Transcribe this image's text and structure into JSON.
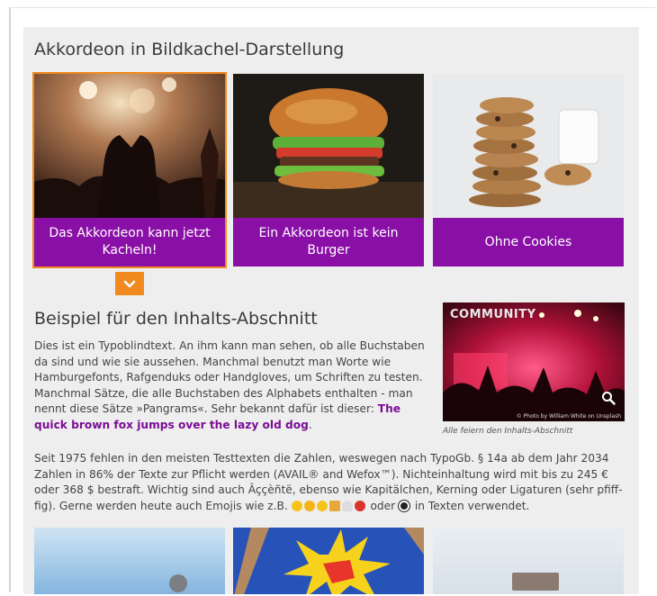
{
  "accordion": {
    "heading": "Akkordeon in Bildkachel-Darstellung",
    "tiles": [
      {
        "caption": "Das Akkordeon kann jetzt Kacheln!",
        "active": true
      },
      {
        "caption": "Ein Akkordeon ist kein Burger",
        "active": false
      },
      {
        "caption": "Ohne Cookies",
        "active": false
      }
    ],
    "toggle_icon": "chevron-down-icon"
  },
  "content": {
    "heading": "Beispiel für den Inhalts-Abschnitt",
    "para1_text": "Dies ist ein Typoblindtext. An ihm kann man sehen, ob alle Buchstaben da sind und wie sie aussehen. Manchmal benutzt man Worte wie Hamburgefonts, Rafgenduks oder Handgloves, um Schriften zu testen. Manchmal Sätze, die alle Buchstaben des Alphabets enthalten - man nennt diese Sätze »Pangrams«. Sehr bekannt dafür ist dieser: ",
    "para1_highlight": "The quick brown fox jumps over the lazy old dog",
    "para1_end": ".",
    "para2_text": "Seit 1975 fehlen in den meisten Testtexten die Zahlen, weswegen nach TypoGb. § 14a ab dem Jahr 2034 Zahlen in 86% der Texte zur Pflicht werden (AVAIL® and Wefox™). Nichteinhaltung wird mit bis zu 245 € oder 368 $ bestraft. Wichtig sind auch Âççèñtë, ebenso wie Kapitälchen, Kerning oder Ligaturen (sehr pfiff-fig). Gerne werden heute auch Emojis wie z.B. ",
    "para2_mid": " oder ",
    "para2_end": " in Texten verwendet.",
    "figure": {
      "sign_text": "COMMUNITY",
      "credit": "© Photo by William White on Unsplash",
      "caption": "Alle feiern den Inhalts-Abschnitt",
      "zoom_icon": "magnifier-icon"
    }
  },
  "colors": {
    "accent": "#8a0fa6",
    "highlight": "#f08a1e",
    "link": "#7a0d95"
  }
}
